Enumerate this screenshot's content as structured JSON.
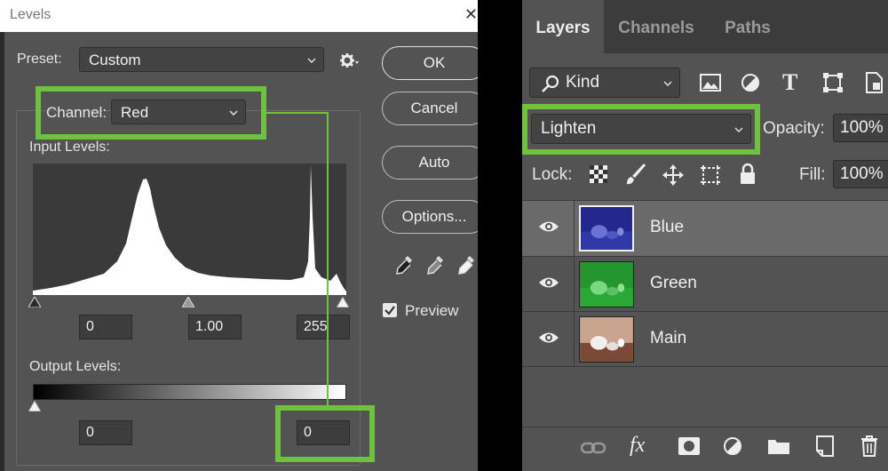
{
  "levels": {
    "title": "Levels",
    "preset_label": "Preset:",
    "preset_value": "Custom",
    "channel_label": "Channel:",
    "channel_value": "Red",
    "input_levels_label": "Input Levels:",
    "input_black": "0",
    "input_gamma": "1.00",
    "input_white": "255",
    "output_levels_label": "Output Levels:",
    "output_black": "0",
    "output_white": "0",
    "buttons": {
      "ok": "OK",
      "cancel": "Cancel",
      "auto": "Auto",
      "options": "Options..."
    },
    "preview_label": "Preview",
    "preview_checked": true,
    "highlight_color": "#6fc23e"
  },
  "layers_panel": {
    "tabs": [
      {
        "label": "Layers",
        "active": true
      },
      {
        "label": "Channels",
        "active": false
      },
      {
        "label": "Paths",
        "active": false
      }
    ],
    "filter_kind": "Kind",
    "blend_mode": "Lighten",
    "opacity_label": "Opacity:",
    "opacity_value": "100%",
    "lock_label": "Lock:",
    "fill_label": "Fill:",
    "fill_value": "100%",
    "layers": [
      {
        "name": "Blue",
        "selected": true,
        "tint": "#2b2fa0"
      },
      {
        "name": "Green",
        "selected": false,
        "tint": "#2fa03a"
      },
      {
        "name": "Main",
        "selected": false,
        "tint": "#a08070"
      }
    ],
    "bottom_icons": [
      "link-icon",
      "fx-icon",
      "mask-icon",
      "adjustment-icon",
      "folder-icon",
      "new-layer-icon",
      "trash-icon"
    ],
    "highlight_color": "#6fc23e"
  }
}
